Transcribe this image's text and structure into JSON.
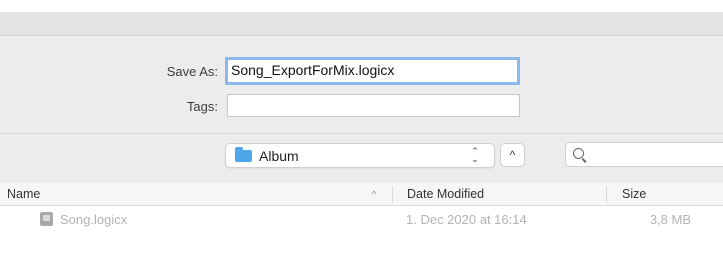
{
  "form": {
    "save_as_label": "Save As:",
    "save_as_value": "Song_ExportForMix.logicx",
    "tags_label": "Tags:",
    "tags_value": ""
  },
  "location": {
    "folder_name": "Album",
    "popup_arrows_icon": "updown-chevrons-icon",
    "collapse_icon": "chevron-up-icon",
    "collapse_glyph": "^",
    "search_icon": "search-icon",
    "search_value": ""
  },
  "file_list": {
    "columns": [
      "Name",
      "Date Modified",
      "Size"
    ],
    "sort_indicator": "^",
    "rows": [
      {
        "name": "Song.logicx",
        "date_modified": "1. Dec 2020 at 16:14",
        "size": "3,8 MB",
        "dimmed": true
      }
    ]
  }
}
